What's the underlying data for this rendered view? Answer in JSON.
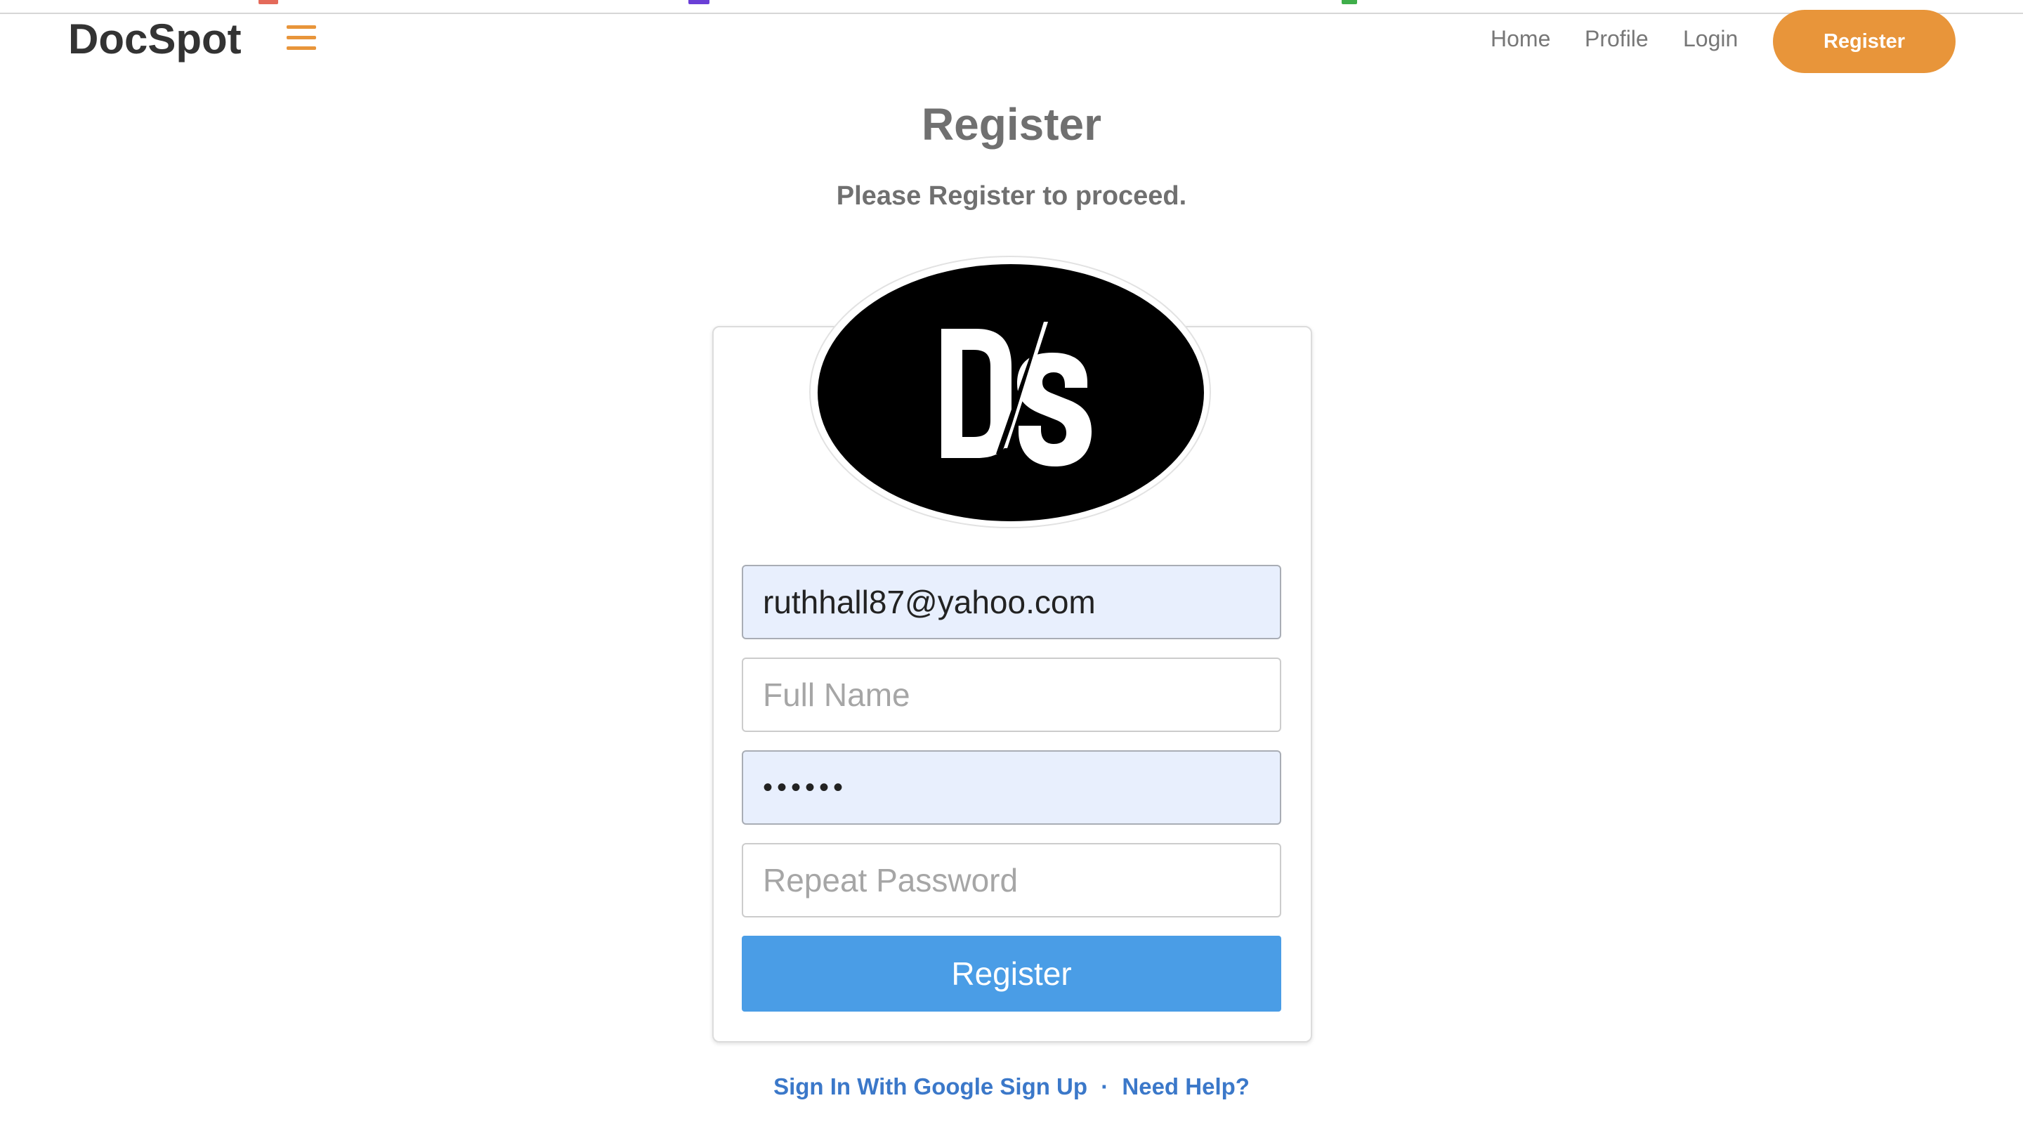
{
  "header": {
    "brand": "DocSpot",
    "nav": {
      "home": "Home",
      "profile": "Profile",
      "login": "Login",
      "register": "Register"
    }
  },
  "main": {
    "title": "Register",
    "subtitle": "Please Register to proceed.",
    "logo_text": "DS"
  },
  "form": {
    "email_value": "ruthhall87@yahoo.com",
    "fullname_placeholder": "Full Name",
    "password_value": "••••••",
    "repeat_password_placeholder": "Repeat Password",
    "submit_label": "Register"
  },
  "footer": {
    "google_signin": "Sign In With Google Sign Up",
    "separator": "·",
    "help": "Need Help?"
  },
  "colors": {
    "accent": "#e8953a",
    "primary_button": "#4a9de6",
    "link": "#3b78c9",
    "autofill_bg": "#e8effd"
  }
}
